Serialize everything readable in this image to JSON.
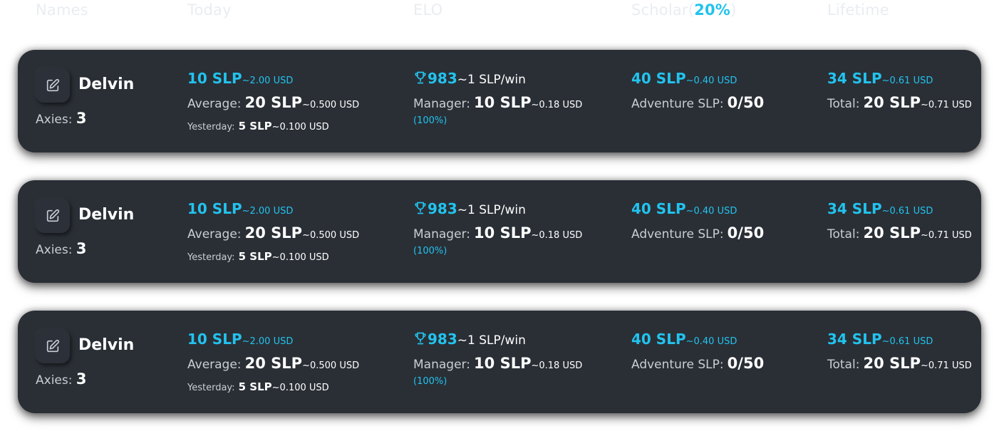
{
  "header": {
    "names": "Names",
    "today": "Today",
    "elo": "ELO",
    "scholar": "Scholar",
    "scholar_paren_open": "(",
    "scholar_pct": "20%",
    "scholar_paren_close": ")",
    "lifetime": "Lifetime"
  },
  "colors": {
    "accent": "#22c3ee",
    "card": "#2a2f36",
    "text": "#c9ced6"
  },
  "icons": {
    "edit": "edit-icon",
    "trophy": "trophy-icon"
  },
  "rows": [
    {
      "name": "Delvin",
      "axies_label": "Axies:",
      "axies_value": "3",
      "today_slp": "10 SLP",
      "today_usd": "~2.00 USD",
      "average_label": "Average:",
      "average_slp": "20 SLP",
      "average_usd": "~0.500 USD",
      "yesterday_label": "Yesterday:",
      "yesterday_slp": "5 SLP",
      "yesterday_usd": "~0.100 USD",
      "elo_value": "983",
      "elo_rate": "~1 SLP/win",
      "manager_label": "Manager:",
      "manager_slp": "10 SLP",
      "manager_usd": "~0.18 USD",
      "manager_pct": "(100%)",
      "scholar_slp": "40 SLP",
      "scholar_usd": "~0.40 USD",
      "adventure_label": "Adventure SLP:",
      "adventure_value": "0/50",
      "lifetime_slp": "34 SLP",
      "lifetime_usd": "~0.61 USD",
      "total_label": "Total:",
      "total_slp": "20 SLP",
      "total_usd": "~0.71 USD"
    },
    {
      "name": "Delvin",
      "axies_label": "Axies:",
      "axies_value": "3",
      "today_slp": "10 SLP",
      "today_usd": "~2.00 USD",
      "average_label": "Average:",
      "average_slp": "20 SLP",
      "average_usd": "~0.500 USD",
      "yesterday_label": "Yesterday:",
      "yesterday_slp": "5 SLP",
      "yesterday_usd": "~0.100 USD",
      "elo_value": "983",
      "elo_rate": "~1 SLP/win",
      "manager_label": "Manager:",
      "manager_slp": "10 SLP",
      "manager_usd": "~0.18 USD",
      "manager_pct": "(100%)",
      "scholar_slp": "40 SLP",
      "scholar_usd": "~0.40 USD",
      "adventure_label": "Adventure SLP:",
      "adventure_value": "0/50",
      "lifetime_slp": "34 SLP",
      "lifetime_usd": "~0.61 USD",
      "total_label": "Total:",
      "total_slp": "20 SLP",
      "total_usd": "~0.71 USD"
    },
    {
      "name": "Delvin",
      "axies_label": "Axies:",
      "axies_value": "3",
      "today_slp": "10 SLP",
      "today_usd": "~2.00 USD",
      "average_label": "Average:",
      "average_slp": "20 SLP",
      "average_usd": "~0.500 USD",
      "yesterday_label": "Yesterday:",
      "yesterday_slp": "5 SLP",
      "yesterday_usd": "~0.100 USD",
      "elo_value": "983",
      "elo_rate": "~1 SLP/win",
      "manager_label": "Manager:",
      "manager_slp": "10 SLP",
      "manager_usd": "~0.18 USD",
      "manager_pct": "(100%)",
      "scholar_slp": "40 SLP",
      "scholar_usd": "~0.40 USD",
      "adventure_label": "Adventure SLP:",
      "adventure_value": "0/50",
      "lifetime_slp": "34 SLP",
      "lifetime_usd": "~0.61 USD",
      "total_label": "Total:",
      "total_slp": "20 SLP",
      "total_usd": "~0.71 USD"
    }
  ]
}
